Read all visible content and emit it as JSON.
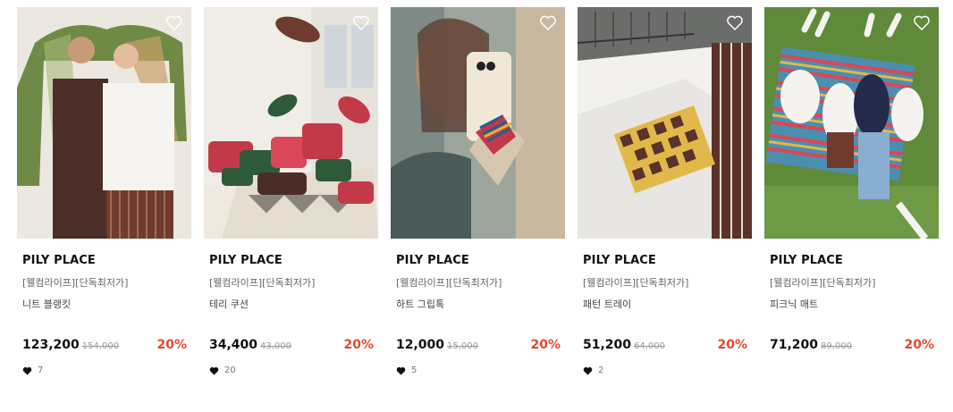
{
  "products": [
    {
      "brand": "PILY PLACE",
      "tag": "[웰컴라이프][단독최저가]",
      "name": "니트 블랭킷",
      "price": "123,200",
      "original_price": "154,000",
      "discount": "20%",
      "likes": "7",
      "image": "couple-under-knit-blanket"
    },
    {
      "brand": "PILY PLACE",
      "tag": "[웰컴라이프][단독최저가]",
      "name": "테리 쿠션",
      "price": "34,400",
      "original_price": "43,000",
      "discount": "20%",
      "likes": "20",
      "image": "floating-terry-cushions"
    },
    {
      "brand": "PILY PLACE",
      "tag": "[웰컴라이프][단독최저가]",
      "name": "하트 그립톡",
      "price": "12,000",
      "original_price": "15,000",
      "discount": "20%",
      "likes": "5",
      "image": "woman-phone-heart-grip"
    },
    {
      "brand": "PILY PLACE",
      "tag": "[웰컴라이프][단독최저가]",
      "name": "패턴 트레이",
      "price": "51,200",
      "original_price": "64,000",
      "discount": "20%",
      "likes": "2",
      "image": "pattern-tray-on-windowsill"
    },
    {
      "brand": "PILY PLACE",
      "tag": "[웰컴라이프][단독최저가]",
      "name": "피크닉 매트",
      "price": "71,200",
      "original_price": "89,000",
      "discount": "20%",
      "likes": "",
      "image": "people-on-picnic-mat"
    }
  ],
  "colors": {
    "discount": "#e8472b",
    "brand_text": "#111111",
    "muted": "#666666"
  }
}
